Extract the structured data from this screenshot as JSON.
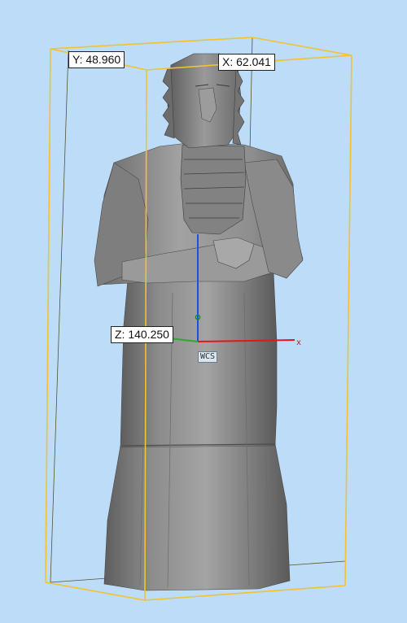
{
  "viewer": {
    "background_color": "#bcdcf7",
    "bounding_box_color": "#f2c230",
    "model_fill_color": "#8a8a8a"
  },
  "dimensions": {
    "x_label": "X: 62.041",
    "y_label": "Y: 48.960",
    "z_label": "Z: 140.250"
  },
  "axes": {
    "x_axis_label": "x",
    "wcs_label": "WCS",
    "x_color": "#e01818",
    "y_color": "#2ea82e",
    "z_color": "#1f4fe0"
  }
}
